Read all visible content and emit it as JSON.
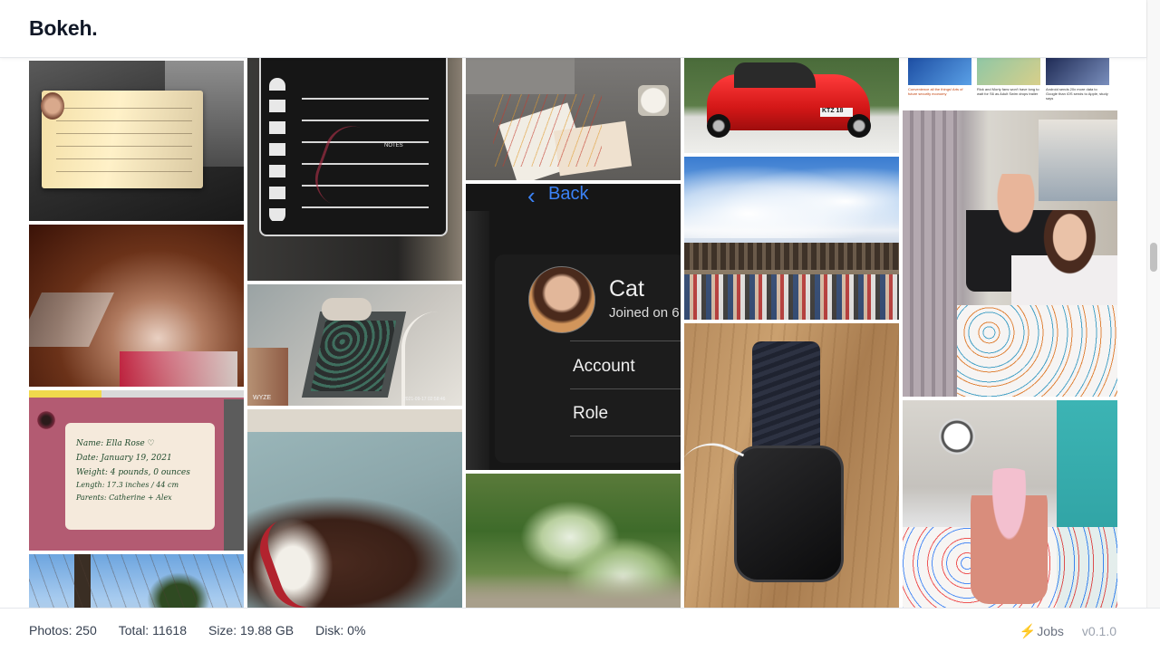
{
  "app": {
    "title": "Bokeh."
  },
  "photos": {
    "phone_screen": {
      "back_label": "Back",
      "profile_name": "Cat",
      "joined_text": "Joined on 6",
      "menu_items": [
        "Account",
        "Role"
      ]
    },
    "name_card": {
      "lines": [
        "Name: Ella Rose ♡",
        "Date: January 19, 2021",
        "Weight: 4 pounds, 0 ounces",
        "Length: 17.3 inches / 44 cm",
        "Parents: Catherine + Alex"
      ]
    },
    "camera_stamp": {
      "brand": "WYZE",
      "timestamp": "2021-09-17 02:58:46"
    },
    "car_plate": "KTZ 18",
    "news_strip": {
      "headlines": [
        "Convenience all the things! Arts of future security economy",
        "Rick and Morty fans won't have long to wait for S6 as Adult Swim drops trailer",
        "Android sends 20x more data to Google than iOS sends to Apple, study says"
      ]
    },
    "chalkboard": {
      "day_letters": [
        "M",
        "T",
        "W",
        "TH",
        "F",
        "SA",
        "SU"
      ],
      "notes_label": "NOTES"
    }
  },
  "footer": {
    "photos": "Photos: 250",
    "total": "Total: 11618",
    "size": "Size: 19.88 GB",
    "disk": "Disk: 0%",
    "jobs_label": "Jobs",
    "version": "v0.1.0"
  },
  "colors": {
    "accent_bolt": "#f59e0b",
    "phone_blue": "#3b82f6",
    "car_red": "#dc2626"
  }
}
